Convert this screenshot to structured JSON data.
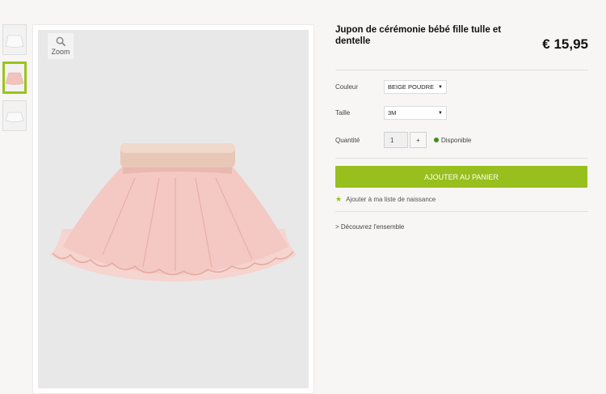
{
  "product": {
    "title": "Jupon de cérémonie bébé fille tulle et dentelle",
    "price": "€ 15,95"
  },
  "gallery": {
    "zoom_label": "Zoom",
    "thumbnails": [
      "thumbnail-1",
      "thumbnail-2",
      "thumbnail-3"
    ],
    "active_index": 1
  },
  "options": {
    "color_label": "Couleur",
    "color_value": "BEIGE POUDRE",
    "size_label": "Taille",
    "size_value": "3M",
    "quantity_label": "Quantité",
    "quantity_value": "1",
    "plus_label": "+",
    "availability": "Disponible"
  },
  "actions": {
    "add_to_cart": "AJOUTER AU PANIER",
    "wishlist": "Ajouter à ma liste de naissance",
    "discover": "> Découvrez l'ensemble"
  },
  "colors": {
    "accent": "#97bf1d",
    "available": "#3d8f1b",
    "background": "#f7f6f4"
  }
}
